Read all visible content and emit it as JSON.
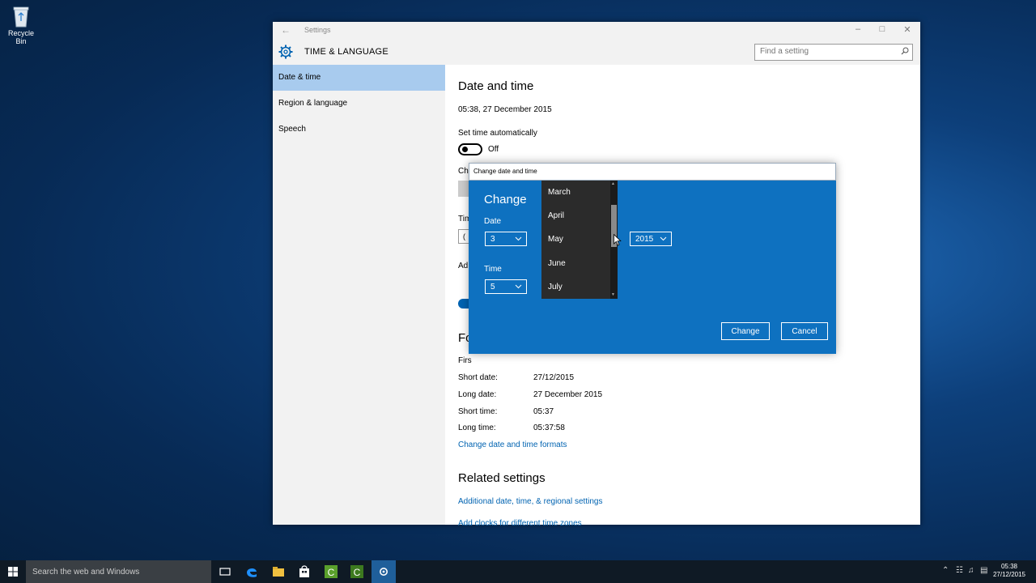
{
  "desktop": {
    "recycle_bin_label": "Recycle Bin"
  },
  "window": {
    "title": "Settings",
    "app_title": "TIME & LANGUAGE",
    "search_placeholder": "Find a setting"
  },
  "sidebar": {
    "items": [
      {
        "label": "Date & time",
        "active": true
      },
      {
        "label": "Region & language"
      },
      {
        "label": "Speech"
      }
    ]
  },
  "content": {
    "heading": "Date and time",
    "current_datetime": "05:38, 27 December 2015",
    "set_time_auto_label": "Set time automatically",
    "set_time_auto_state": "Off",
    "change_label_partial": "Ch",
    "timezone_label_partial": "Tim",
    "timezone_value_partial": "(",
    "adjust_label_partial": "Ad",
    "formats_heading_partial": "Fo",
    "first_day_label_partial": "Firs",
    "short_date_label": "Short date:",
    "short_date_value": "27/12/2015",
    "long_date_label": "Long date:",
    "long_date_value": "27 December 2015",
    "short_time_label": "Short time:",
    "short_time_value": "05:37",
    "long_time_label": "Long time:",
    "long_time_value": "05:37:58",
    "change_formats_link": "Change date and time formats",
    "related_heading": "Related settings",
    "related_link_1": "Additional date, time, & regional settings",
    "related_link_2": "Add clocks for different time zones"
  },
  "dialog": {
    "title": "Change date and time",
    "heading": "Change da",
    "date_label": "Date",
    "day_value": "3",
    "year_value": "2015",
    "time_label": "Time",
    "hour_value": "5",
    "months": [
      "March",
      "April",
      "May",
      "June",
      "July"
    ],
    "change_button": "Change",
    "cancel_button": "Cancel"
  },
  "taskbar": {
    "search_placeholder": "Search the web and Windows",
    "time": "05:38",
    "date": "27/12/2015"
  },
  "colors": {
    "accent": "#0e71c0",
    "sidebar_active": "#a8cbee",
    "link": "#0063b1",
    "taskbar": "#0f1a25"
  }
}
